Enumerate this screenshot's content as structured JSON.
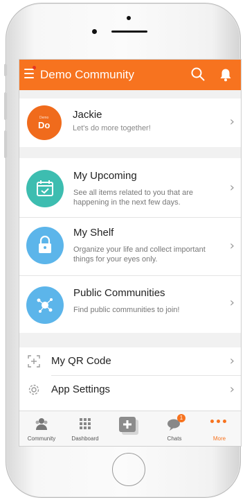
{
  "app_bar": {
    "title": "Demo Community"
  },
  "profile": {
    "name": "Jackie",
    "tagline": "Let's do more together!",
    "avatar_small": "Demo",
    "avatar_big": "Do"
  },
  "features": [
    {
      "title": "My Upcoming",
      "desc_line1": "See all items related to you that are",
      "desc_line2": "happening in the next few days."
    },
    {
      "title": "My Shelf",
      "desc_line1": "Organize your life and collect important",
      "desc_line2": "things for your eyes only."
    },
    {
      "title": "Public Communities",
      "desc_line1": "Find public communities to join!",
      "desc_line2": ""
    }
  ],
  "settings": [
    {
      "label": "My QR Code"
    },
    {
      "label": "App Settings"
    }
  ],
  "tabs": [
    {
      "label": "Community"
    },
    {
      "label": "Dashboard"
    },
    {
      "label": ""
    },
    {
      "label": "Chats",
      "badge": "1"
    },
    {
      "label": "More"
    }
  ],
  "colors": {
    "accent": "#f7731f",
    "upcoming": "#3dbdb0",
    "shelf": "#5cb5ea",
    "communities": "#5cb5ea"
  },
  "icons": [
    "menu-icon",
    "search-icon",
    "bell-icon",
    "calendar-icon",
    "lock-icon",
    "network-icon",
    "qr-code-icon",
    "gear-icon",
    "community-icon",
    "dashboard-icon",
    "add-icon",
    "chat-icon",
    "more-icon",
    "chevron-right-icon"
  ]
}
